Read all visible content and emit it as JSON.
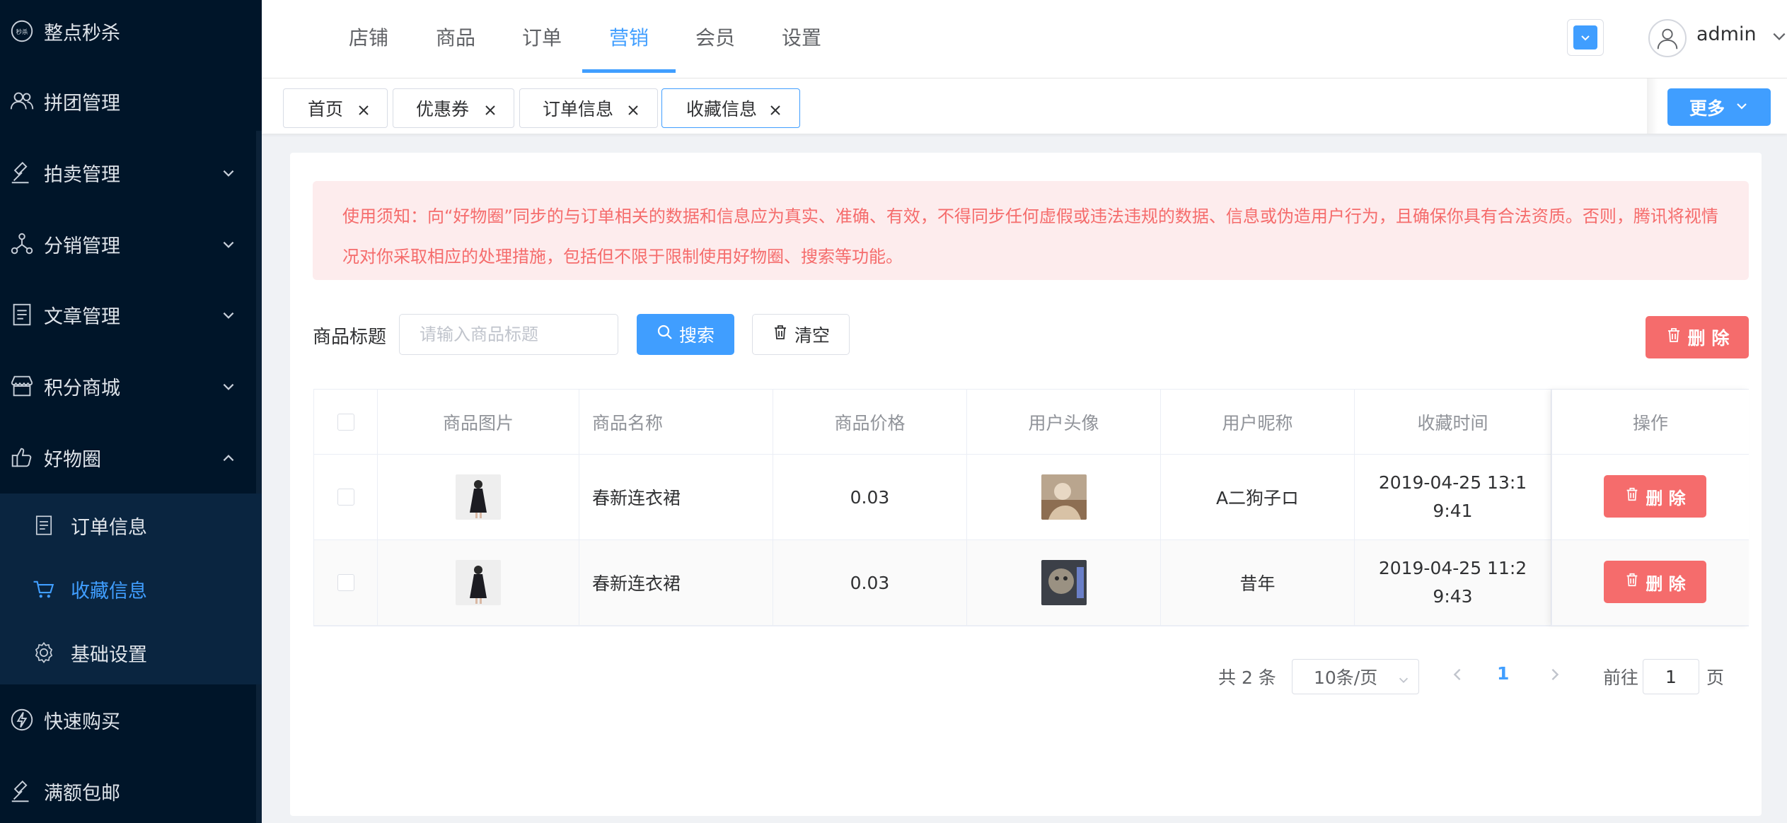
{
  "sidebar": {
    "items": [
      {
        "label": "整点秒杀"
      },
      {
        "label": "拼团管理"
      },
      {
        "label": "拍卖管理"
      },
      {
        "label": "分销管理"
      },
      {
        "label": "文章管理"
      },
      {
        "label": "积分商城"
      },
      {
        "label": "好物圈"
      },
      {
        "label": "快速购买"
      },
      {
        "label": "满额包邮"
      }
    ],
    "submenu": [
      {
        "label": "订单信息"
      },
      {
        "label": "收藏信息"
      },
      {
        "label": "基础设置"
      }
    ]
  },
  "navbar": {
    "tabs": [
      "店铺",
      "商品",
      "订单",
      "营销",
      "会员",
      "设置"
    ],
    "active_tab": "营销",
    "username": "admin"
  },
  "tags": [
    {
      "label": "首页"
    },
    {
      "label": "优惠券"
    },
    {
      "label": "订单信息"
    },
    {
      "label": "收藏信息"
    }
  ],
  "more_label": "更多",
  "notice": "使用须知：向“好物圈”同步的与订单相关的数据和信息应为真实、准确、有效，不得同步任何虚假或违法违规的数据、信息或伪造用户行为，且确保你具有合法资质。否则，腾讯将视情况对你采取相应的处理措施，包括但不限于限制使用好物圈、搜索等功能。",
  "search": {
    "label": "商品标题",
    "placeholder": "请输入商品标题",
    "search_btn": "搜索",
    "clear_btn": "清空",
    "delete_btn": "删 除"
  },
  "table": {
    "headers": [
      "商品图片",
      "商品名称",
      "商品价格",
      "用户头像",
      "用户昵称",
      "收藏时间",
      "操作"
    ],
    "rows": [
      {
        "name": "春新连衣裙",
        "price": "0.03",
        "nickname": "A二狗子ロ",
        "time": "2019-04-25 13:19:41",
        "action": "删 除"
      },
      {
        "name": "春新连衣裙",
        "price": "0.03",
        "nickname": "昔年",
        "time": "2019-04-25 11:29:43",
        "action": "删 除"
      }
    ]
  },
  "pagination": {
    "total": "共 2 条",
    "page_size": "10条/页",
    "current": "1",
    "goto_label": "前往",
    "goto_value": "1",
    "page_suffix": "页"
  },
  "colors": {
    "sidebar_bg": "#001529",
    "primary": "#409eff",
    "danger": "#f56c6c",
    "notice_bg": "#fdeced"
  }
}
